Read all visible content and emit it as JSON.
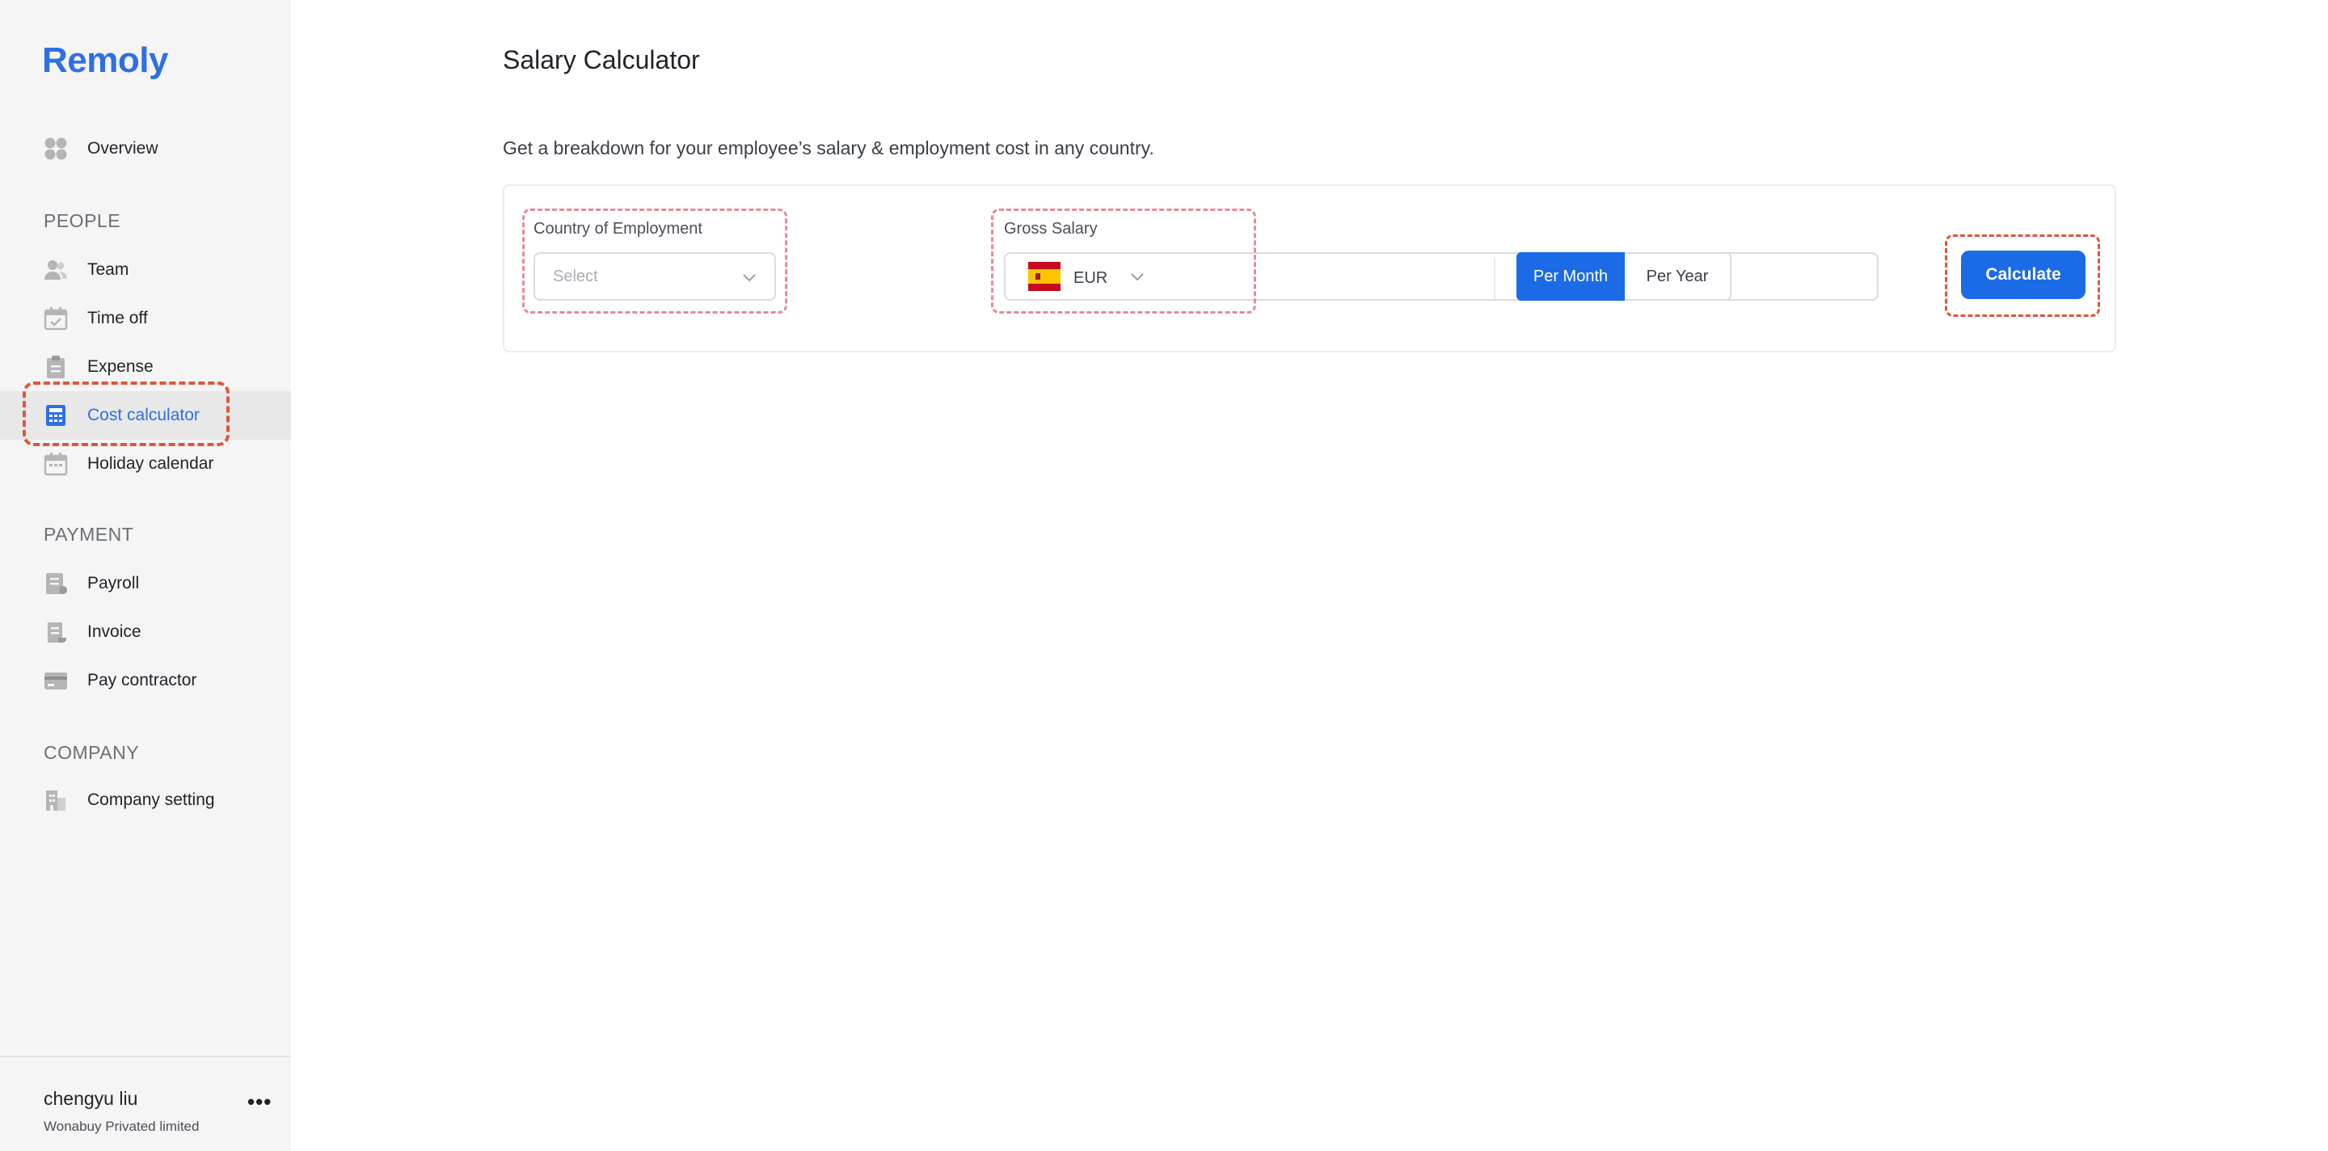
{
  "app": {
    "logo": "Remoly",
    "accent_color": "#2f6fe4",
    "button_color": "#1b6be6",
    "highlight_color": "#e0553a"
  },
  "sidebar": {
    "overview": {
      "label": "Overview",
      "icon": "grid-icon"
    },
    "sections": {
      "people": "PEOPLE",
      "payment": "PAYMENT",
      "company": "COMPANY"
    },
    "people_items": [
      {
        "label": "Team",
        "icon": "users-icon"
      },
      {
        "label": "Time off",
        "icon": "calendar-check-icon"
      },
      {
        "label": "Expense",
        "icon": "clipboard-icon"
      },
      {
        "label": "Cost calculator",
        "icon": "calculator-icon",
        "active": true
      },
      {
        "label": "Holiday calendar",
        "icon": "calendar-icon"
      }
    ],
    "payment_items": [
      {
        "label": "Payroll",
        "icon": "document-icon"
      },
      {
        "label": "Invoice",
        "icon": "receipt-icon"
      },
      {
        "label": "Pay contractor",
        "icon": "card-icon"
      }
    ],
    "company_items": [
      {
        "label": "Company setting",
        "icon": "building-icon"
      }
    ],
    "user": {
      "name": "chengyu liu",
      "org": "Wonabuy Privated limited",
      "more": "•••"
    }
  },
  "main": {
    "title": "Salary Calculator",
    "description": "Get a breakdown for your employee’s salary & employment cost in any country.",
    "country": {
      "label": "Country of Employment",
      "placeholder": "Select"
    },
    "salary": {
      "label": "Gross Salary",
      "currency": "EUR",
      "flag": "spain-flag-icon",
      "value": ""
    },
    "period": {
      "per_month": "Per Month",
      "per_year": "Per Year",
      "selected": "Per Month"
    },
    "calculate_label": "Calculate"
  }
}
